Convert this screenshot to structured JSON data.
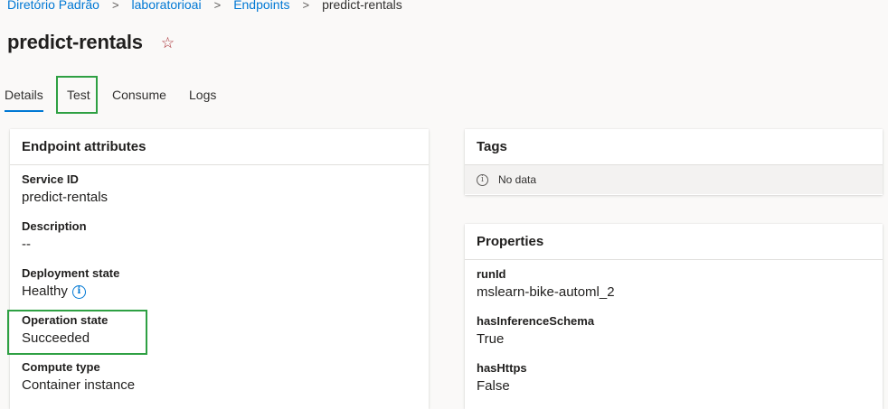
{
  "breadcrumb": {
    "items": [
      "Diretório Padrão",
      "laboratorioai",
      "Endpoints"
    ],
    "separator": ">",
    "current": "predict-rentals"
  },
  "page": {
    "title": "predict-rentals",
    "favorite_icon": "star-outline-icon"
  },
  "tabs": [
    {
      "label": "Details",
      "active": true
    },
    {
      "label": "Test",
      "active": false,
      "highlighted": true
    },
    {
      "label": "Consume",
      "active": false
    },
    {
      "label": "Logs",
      "active": false
    }
  ],
  "endpoint_attributes": {
    "title": "Endpoint attributes",
    "fields": [
      {
        "label": "Service ID",
        "value": "predict-rentals"
      },
      {
        "label": "Description",
        "value": "--"
      },
      {
        "label": "Deployment state",
        "value": "Healthy",
        "icon": "info-icon"
      },
      {
        "label": "Operation state",
        "value": "Succeeded",
        "highlighted": true
      },
      {
        "label": "Compute type",
        "value": "Container instance"
      }
    ]
  },
  "tags": {
    "title": "Tags",
    "empty_text": "No data",
    "icon": "info-icon"
  },
  "properties": {
    "title": "Properties",
    "fields": [
      {
        "label": "runId",
        "value": "mslearn-bike-automl_2"
      },
      {
        "label": "hasInferenceSchema",
        "value": "True"
      },
      {
        "label": "hasHttps",
        "value": "False"
      }
    ]
  },
  "colors": {
    "accent": "#0078d4",
    "highlight_border": "#2ea043",
    "favorite": "#a4262c"
  }
}
